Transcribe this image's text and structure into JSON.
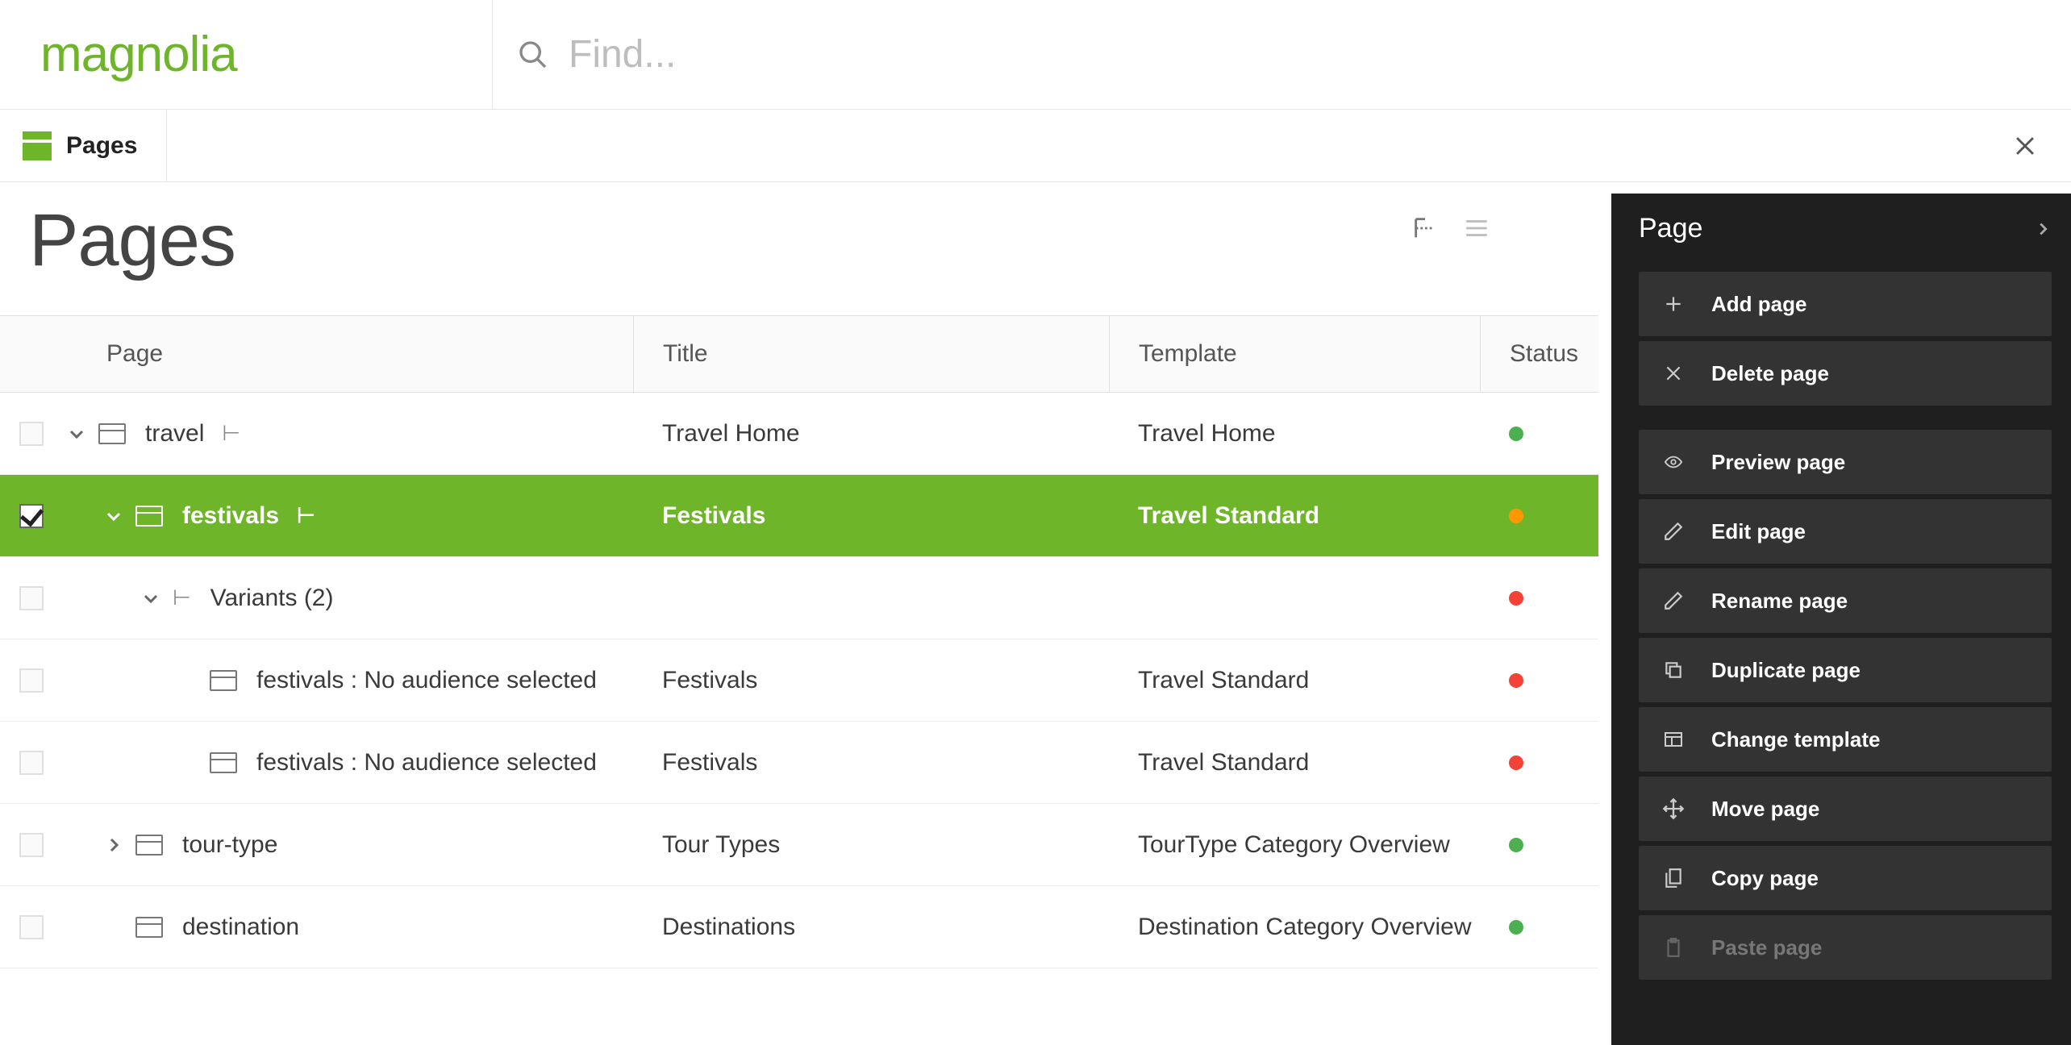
{
  "brand": "magnolia",
  "search": {
    "placeholder": "Find..."
  },
  "tab": {
    "label": "Pages"
  },
  "page_heading": "Pages",
  "columns": {
    "page": "Page",
    "title": "Title",
    "template": "Template",
    "status": "Status"
  },
  "rows": [
    {
      "indent": 0,
      "expand": "down",
      "icon": "page",
      "trailing_glyph": true,
      "name": "travel",
      "title": "Travel Home",
      "template": "Travel Home",
      "status": "green",
      "selected": false,
      "checked": false
    },
    {
      "indent": 1,
      "expand": "down",
      "icon": "page",
      "trailing_glyph": true,
      "name": "festivals",
      "title": "Festivals",
      "template": "Travel Standard",
      "status": "orange",
      "selected": true,
      "checked": true
    },
    {
      "indent": 2,
      "expand": "down",
      "icon": "tree",
      "trailing_glyph": false,
      "name": "Variants (2)",
      "title": "",
      "template": "",
      "status": "red",
      "selected": false,
      "checked": false
    },
    {
      "indent": 3,
      "expand": "none",
      "icon": "page",
      "trailing_glyph": false,
      "name": "festivals : No audience selected",
      "title": "Festivals",
      "template": "Travel Standard",
      "status": "red",
      "selected": false,
      "checked": false
    },
    {
      "indent": 3,
      "expand": "none",
      "icon": "page",
      "trailing_glyph": false,
      "name": "festivals : No audience selected",
      "title": "Festivals",
      "template": "Travel Standard",
      "status": "red",
      "selected": false,
      "checked": false
    },
    {
      "indent": 1,
      "expand": "right",
      "icon": "page",
      "trailing_glyph": false,
      "name": "tour-type",
      "title": "Tour Types",
      "template": "TourType Category Overview",
      "status": "green",
      "selected": false,
      "checked": false
    },
    {
      "indent": 1,
      "expand": "none",
      "icon": "page",
      "trailing_glyph": false,
      "name": "destination",
      "title": "Destinations",
      "template": "Destination Category Overview",
      "status": "green",
      "selected": false,
      "checked": false
    }
  ],
  "side": {
    "title": "Page",
    "groups": [
      [
        {
          "icon": "plus",
          "label": "Add page",
          "disabled": false
        },
        {
          "icon": "x",
          "label": "Delete page",
          "disabled": false
        }
      ],
      [
        {
          "icon": "eye",
          "label": "Preview page",
          "disabled": false
        },
        {
          "icon": "pencil",
          "label": "Edit page",
          "disabled": false
        },
        {
          "icon": "pencil",
          "label": "Rename page",
          "disabled": false
        },
        {
          "icon": "duplicate",
          "label": "Duplicate page",
          "disabled": false
        },
        {
          "icon": "template",
          "label": "Change template",
          "disabled": false
        },
        {
          "icon": "move",
          "label": "Move page",
          "disabled": false
        },
        {
          "icon": "copy",
          "label": "Copy page",
          "disabled": false
        },
        {
          "icon": "paste",
          "label": "Paste page",
          "disabled": true
        }
      ]
    ]
  }
}
